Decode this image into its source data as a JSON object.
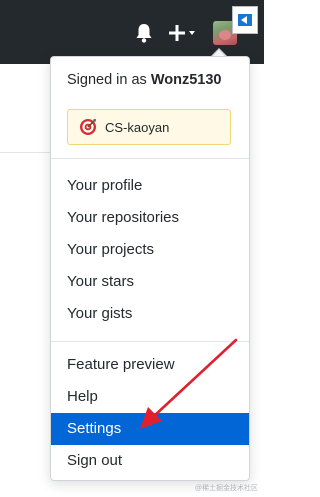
{
  "header": {
    "notifications_icon": "bell-icon",
    "create_icon": "plus-icon",
    "avatar_icon": "user-avatar",
    "collapse_icon": "collapse-left-icon"
  },
  "dropdown": {
    "signed_in_prefix": "Signed in as ",
    "username": "Wonz5130",
    "status": {
      "emoji_icon": "dart-target-icon",
      "text": "CS-kaoyan"
    },
    "profile_items": [
      "Your profile",
      "Your repositories",
      "Your projects",
      "Your stars",
      "Your gists"
    ],
    "account_items": [
      "Feature preview",
      "Help",
      "Settings"
    ],
    "sign_out": "Sign out",
    "selected": "Settings"
  },
  "colors": {
    "header": "#24292e",
    "active": "#0366d6",
    "arrow": "#e0202e",
    "status_bg": "#fff9e5"
  },
  "watermark": "@稀土掘金技术社区"
}
